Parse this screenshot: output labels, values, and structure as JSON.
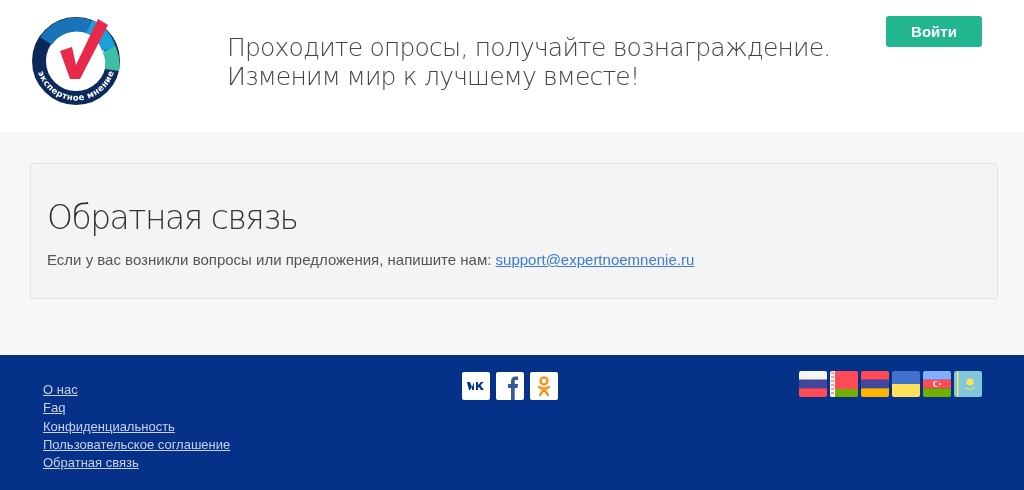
{
  "header": {
    "logo_text": "экспертное мнение",
    "tagline": [
      "Проходите опросы, получайте вознаграждение.",
      "Изменим мир к лучшему вместе!"
    ],
    "login_button": "Войти"
  },
  "feedback": {
    "title": "Обратная связь",
    "text": "Если у вас возникли вопросы или предложения, напишите нам: ",
    "email": "support@expertnoemnenie.ru"
  },
  "footer": {
    "links": [
      "О нас",
      "Faq",
      "Конфиденциальность",
      "Пользовательское соглашение",
      "Обратная связь"
    ],
    "social": [
      {
        "kind": "vk"
      },
      {
        "kind": "facebook"
      },
      {
        "kind": "odnoklassniki"
      }
    ],
    "flags": [
      {
        "kind": "russia"
      },
      {
        "kind": "belarus"
      },
      {
        "kind": "armenia"
      },
      {
        "kind": "ukraine"
      },
      {
        "kind": "azerbaijan"
      },
      {
        "kind": "kazakhstan"
      }
    ]
  }
}
